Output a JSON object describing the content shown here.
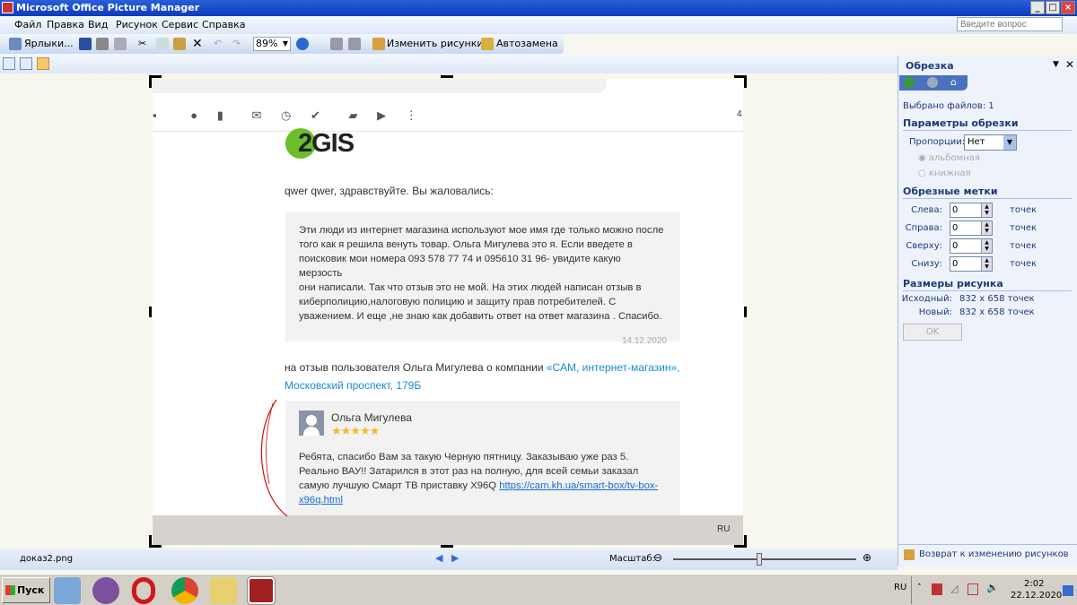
{
  "window": {
    "title": "Microsoft Office Picture Manager",
    "ask_placeholder": "Введите вопрос"
  },
  "menu": [
    "Файл",
    "Правка",
    "Вид",
    "Рисунок",
    "Сервис",
    "Справка"
  ],
  "toolbar": {
    "shortcuts": "Ярлыки...",
    "zoom": "89%",
    "edit_pictures": "Изменить рисунки...",
    "autocorrect": "Автозамена"
  },
  "image": {
    "logo": "2GIS",
    "page_num": "4",
    "greeting": "qwer qwer, здравствуйте. Вы жаловались:",
    "complaint_lines": [
      "Эти люди из интернет магазина используют мое имя где только можно после",
      "того как я решила венуть товар. Ольга Мигулева это я. Если введете в",
      "поисковик мои номера 093 578 77 74 и 095610 31 96- увидите какую мерзость",
      "они написали. Так что отзыв это не мой. На этих людей написан отзыв в",
      "киберполицию,налоговую полицию и защиту прав потребителей. С",
      "уважением. И еще ,не знаю как добавить ответ на ответ магазина . Спасибо."
    ],
    "complaint_date": "14.12.2020",
    "ref_prefix": "на отзыв пользователя Ольга Мигулева о компании ",
    "ref_link_1": "«САМ, интернет-магазин»,",
    "ref_link_2": "Московский проспект, 179Б",
    "review_author": "Ольга Мигулева",
    "review_rating": 5,
    "review_lines": [
      "Ребята, спасибо Вам за такую Черную пятницу. Заказываю уже раз 5.",
      "Реально ВАУ!! Затарился в этот раз на полную, для всей семьи заказал"
    ],
    "review_line3": "самую лучшую Смарт ТВ приставку X96Q ",
    "review_link_1": "https://cam.kh.ua/smart-box/tv-box-",
    "review_link_2": "x96q.html",
    "inner_lang": "RU"
  },
  "panel": {
    "title": "Обрезка",
    "selected": "Выбрано файлов: 1",
    "crop_params": "Параметры обрезки",
    "proportions_label": "Пропорции:",
    "proportions_value": "Нет",
    "landscape": "альбомная",
    "portrait": "книжная",
    "crop_marks": "Обрезные метки",
    "marks": [
      {
        "label": "Слева:",
        "value": "0"
      },
      {
        "label": "Справа:",
        "value": "0"
      },
      {
        "label": "Сверху:",
        "value": "0"
      },
      {
        "label": "Снизу:",
        "value": "0"
      }
    ],
    "unit": "точек",
    "sizes": "Размеры рисунка",
    "original_label": "Исходный:",
    "original_value": "832 x 658 точек",
    "new_label": "Новый:",
    "new_value": "832 x 658 точек",
    "ok": "OK",
    "back": "Возврат к изменению рисунков"
  },
  "status": {
    "filename": "доказ2.png",
    "zoom_label": "Масштаб:",
    "zoom_fraction": 0.5
  },
  "taskbar": {
    "start": "Пуск",
    "lang": "RU",
    "time": "2:02",
    "date": "22.12.2020"
  },
  "colors": {
    "link": "#1a8ad4",
    "star": "#f5b82e",
    "logo_green": "#6cbf2c",
    "annotation": "#d01010"
  }
}
